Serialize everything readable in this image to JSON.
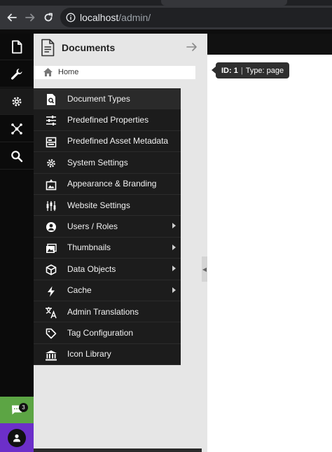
{
  "browser": {
    "url_host": "localhost",
    "url_path": "/admin/"
  },
  "panel": {
    "title": "Documents",
    "tree_root": "Home"
  },
  "tooltip": {
    "id_label": "ID: 1",
    "separator": "|",
    "type_label": "Type: page"
  },
  "settings_menu": {
    "items": [
      {
        "label": "Document Types",
        "icon": "document-search-icon",
        "has_submenu": false
      },
      {
        "label": "Predefined Properties",
        "icon": "sliders-icon",
        "has_submenu": false
      },
      {
        "label": "Predefined Asset Metadata",
        "icon": "metadata-icon",
        "has_submenu": false
      },
      {
        "label": "System Settings",
        "icon": "gear-icon",
        "has_submenu": false
      },
      {
        "label": "Appearance & Branding",
        "icon": "image-frame-icon",
        "has_submenu": false
      },
      {
        "label": "Website Settings",
        "icon": "candles-icon",
        "has_submenu": false
      },
      {
        "label": "Users / Roles",
        "icon": "user-circle-icon",
        "has_submenu": true
      },
      {
        "label": "Thumbnails",
        "icon": "photos-icon",
        "has_submenu": true
      },
      {
        "label": "Data Objects",
        "icon": "cube-icon",
        "has_submenu": true
      },
      {
        "label": "Cache",
        "icon": "lightning-icon",
        "has_submenu": true
      },
      {
        "label": "Admin Translations",
        "icon": "translate-icon",
        "has_submenu": false
      },
      {
        "label": "Tag Configuration",
        "icon": "tag-icon",
        "has_submenu": false
      },
      {
        "label": "Icon Library",
        "icon": "library-icon",
        "has_submenu": false
      }
    ]
  },
  "notifications": {
    "count": "3",
    "accent": "#5ca544"
  },
  "colors": {
    "avatar_bg": "#6c2fc9",
    "menu_bg": "#1c1c1c",
    "rail_bg": "#0b0b0b"
  }
}
